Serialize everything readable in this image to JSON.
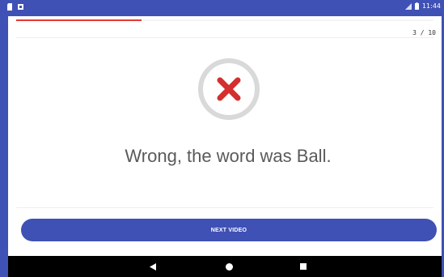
{
  "status_bar": {
    "time": "11:44",
    "left_icons": [
      "sd-card-icon",
      "notification-icon"
    ],
    "right_icons": [
      "signal-icon",
      "battery-icon"
    ]
  },
  "progress": {
    "fraction": 0.3
  },
  "counter": "3 / 10",
  "result": {
    "icon": "wrong-x-icon",
    "message": "Wrong, the word was Ball."
  },
  "actions": {
    "next_label": "NEXT VIDEO"
  },
  "nav_bar": {
    "buttons": [
      "back-icon",
      "home-icon",
      "recents-icon"
    ]
  },
  "colors": {
    "primary": "#3f51b5",
    "error_red": "#d32f2f",
    "progress_red": "#e53935",
    "ring_grey": "#d9d9d9"
  }
}
